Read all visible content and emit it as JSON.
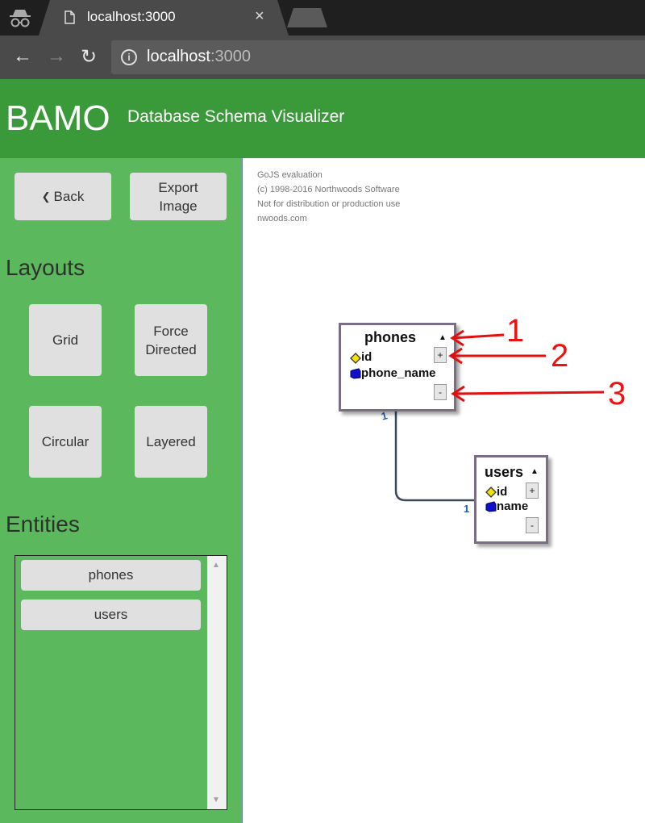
{
  "browser": {
    "tab_title": "localhost:3000",
    "close_glyph": "×",
    "url_host": "localhost",
    "url_port": ":3000",
    "info_glyph": "i",
    "back_glyph": "←",
    "forward_glyph": "→",
    "reload_glyph": "↻"
  },
  "header": {
    "brand": "BAMO",
    "subtitle": "Database Schema Visualizer",
    "color": "#3a9a3a"
  },
  "sidebar": {
    "color": "#5cb85c",
    "back_label": "Back",
    "back_glyph": "❮",
    "export_label_1": "Export",
    "export_label_2": "Image",
    "layouts_title": "Layouts",
    "layouts": {
      "grid": "Grid",
      "force_1": "Force",
      "force_2": "Directed",
      "circular": "Circular",
      "layered": "Layered"
    },
    "entities_title": "Entities",
    "entities": [
      "phones",
      "users"
    ],
    "scroll_up": "▲",
    "scroll_down": "▼"
  },
  "diagram": {
    "watermark": [
      "GoJS evaluation",
      "(c) 1998-2016 Northwoods Software",
      "Not for distribution or production use",
      "nwoods.com"
    ],
    "tables": [
      {
        "name": "phones",
        "fields": [
          {
            "name": "id",
            "icon": "primary-key-icon"
          },
          {
            "name": "phone_name",
            "icon": "column-icon"
          }
        ],
        "expand_label": "+",
        "collapse_label": "-",
        "toggle_glyph": "▲"
      },
      {
        "name": "users",
        "fields": [
          {
            "name": "id",
            "icon": "primary-key-icon"
          },
          {
            "name": "name",
            "icon": "column-icon"
          }
        ],
        "expand_label": "+",
        "collapse_label": "-",
        "toggle_glyph": "▲"
      }
    ],
    "link": {
      "from_cardinality": "1",
      "to_cardinality": "1"
    }
  },
  "annotations": {
    "one": "1",
    "two": "2",
    "three": "3",
    "color": "#e11111"
  }
}
